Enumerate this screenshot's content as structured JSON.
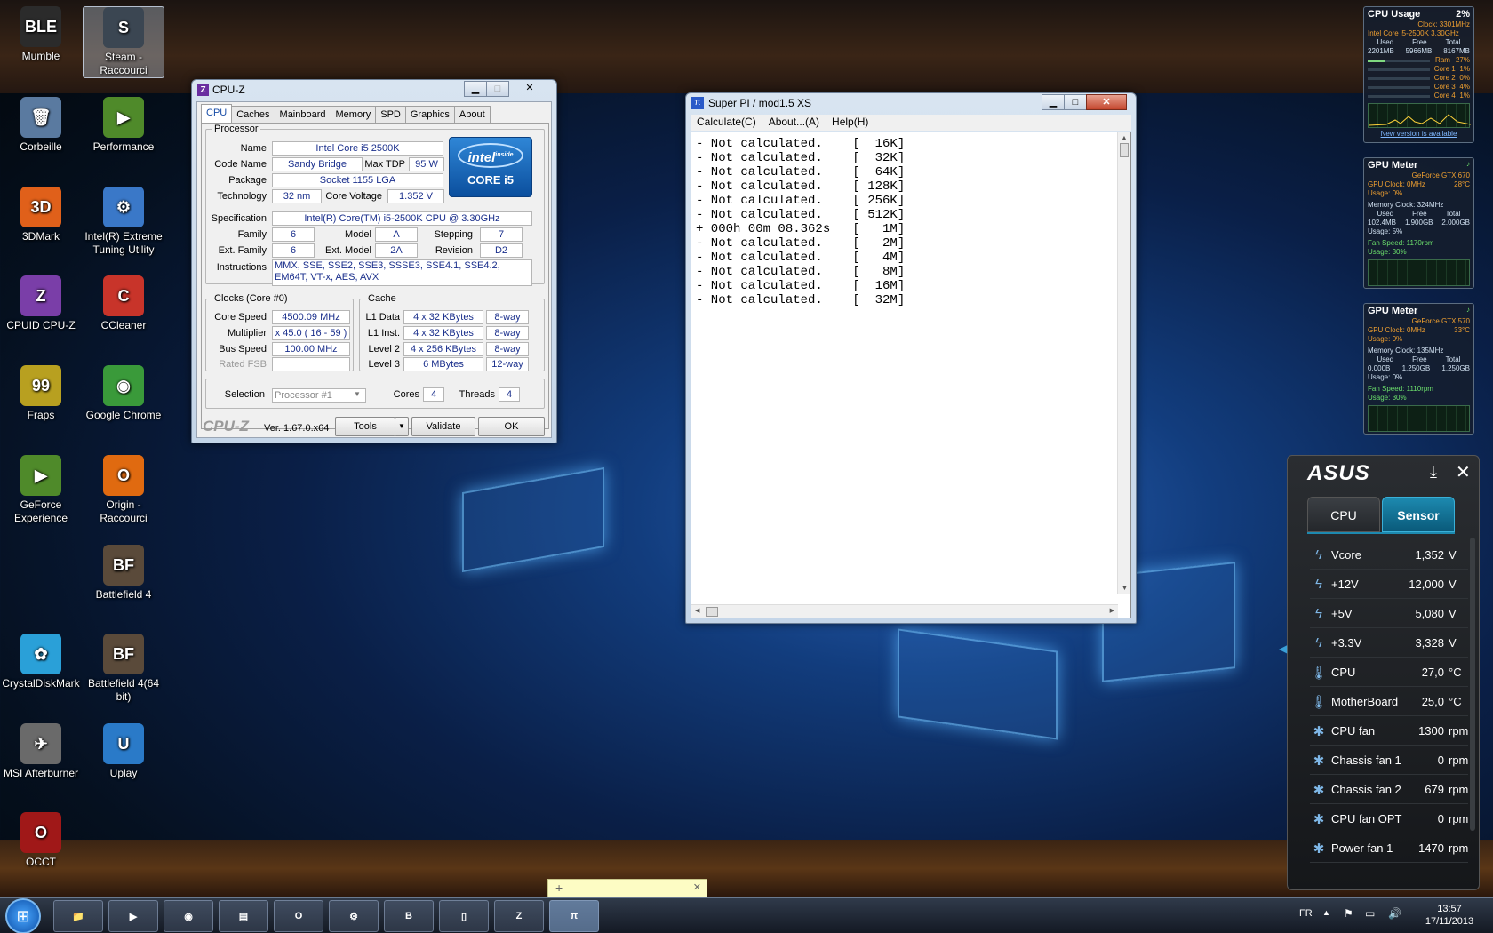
{
  "desktop": {
    "icons": [
      {
        "label": "Mumble",
        "glyph": "BLE",
        "color": "#2b2b2b"
      },
      {
        "label": "Steam - Raccourci",
        "glyph": "S",
        "color": "#3b4652"
      },
      {
        "label": "Corbeille",
        "glyph": "🗑",
        "color": "#5a7aa0"
      },
      {
        "label": "Performance",
        "glyph": "▶",
        "color": "#4f8a2a"
      },
      {
        "label": "3DMark",
        "glyph": "3D",
        "color": "#e0601a"
      },
      {
        "label": "Intel(R) Extreme Tuning Utility",
        "glyph": "⚙",
        "color": "#3a78c8"
      },
      {
        "label": "CPUID CPU-Z",
        "glyph": "Z",
        "color": "#7a3ea8"
      },
      {
        "label": "CCleaner",
        "glyph": "C",
        "color": "#c8342a"
      },
      {
        "label": "Fraps",
        "glyph": "99",
        "color": "#b8a020"
      },
      {
        "label": "Google Chrome",
        "glyph": "◉",
        "color": "#3a9a3a"
      },
      {
        "label": "GeForce Experience",
        "glyph": "▶",
        "color": "#4f8a2a"
      },
      {
        "label": "Origin - Raccourci",
        "glyph": "O",
        "color": "#e06a10"
      },
      {
        "label": "Battlefield 4",
        "glyph": "BF",
        "color": "#5a4a3a"
      },
      {
        "label": "CrystalDiskMark",
        "glyph": "✿",
        "color": "#2aa0d8"
      },
      {
        "label": "Battlefield 4(64 bit)",
        "glyph": "BF",
        "color": "#5a4a3a"
      },
      {
        "label": "MSI Afterburner",
        "glyph": "✈",
        "color": "#6a6a6a"
      },
      {
        "label": "Uplay",
        "glyph": "U",
        "color": "#2a7ac8"
      },
      {
        "label": "OCCT",
        "glyph": "O",
        "color": "#a01818"
      }
    ]
  },
  "cpuz": {
    "title": "CPU-Z",
    "tabs": [
      "CPU",
      "Caches",
      "Mainboard",
      "Memory",
      "SPD",
      "Graphics",
      "About"
    ],
    "processor_label": "Processor",
    "name_label": "Name",
    "name": "Intel Core i5 2500K",
    "codename_label": "Code Name",
    "codename": "Sandy Bridge",
    "maxtdp_label": "Max TDP",
    "maxtdp": "95 W",
    "package_label": "Package",
    "package": "Socket 1155 LGA",
    "tech_label": "Technology",
    "tech": "32 nm",
    "voltage_label": "Core Voltage",
    "voltage": "1.352 V",
    "spec_label": "Specification",
    "spec": "Intel(R) Core(TM) i5-2500K CPU @ 3.30GHz",
    "family_label": "Family",
    "family": "6",
    "model_label": "Model",
    "model": "A",
    "stepping_label": "Stepping",
    "stepping": "7",
    "extfamily_label": "Ext. Family",
    "extfamily": "6",
    "extmodel_label": "Ext. Model",
    "extmodel": "2A",
    "revision_label": "Revision",
    "revision": "D2",
    "instr_label": "Instructions",
    "instr": "MMX, SSE, SSE2, SSE3, SSSE3, SSE4.1, SSE4.2, EM64T, VT-x, AES, AVX",
    "intel_logo": {
      "top": "intel",
      "inside": "inside",
      "bottom": "CORE i5"
    },
    "clocks_label": "Clocks (Core #0)",
    "corespeed_label": "Core Speed",
    "corespeed": "4500.09 MHz",
    "mult_label": "Multiplier",
    "mult": "x 45.0 ( 16 - 59 )",
    "bus_label": "Bus Speed",
    "bus": "100.00 MHz",
    "fsb_label": "Rated FSB",
    "cache_label": "Cache",
    "l1d_label": "L1 Data",
    "l1d": "4 x 32 KBytes",
    "l1d_way": "8-way",
    "l1i_label": "L1 Inst.",
    "l1i": "4 x 32 KBytes",
    "l1i_way": "8-way",
    "l2_label": "Level 2",
    "l2": "4 x 256 KBytes",
    "l2_way": "8-way",
    "l3_label": "Level 3",
    "l3": "6 MBytes",
    "l3_way": "12-way",
    "selection_label": "Selection",
    "selection": "Processor #1",
    "cores_label": "Cores",
    "cores": "4",
    "threads_label": "Threads",
    "threads": "4",
    "brand": "CPU-Z",
    "version": "Ver. 1.67.0.x64",
    "tools_btn": "Tools",
    "validate_btn": "Validate",
    "ok_btn": "OK"
  },
  "superpi": {
    "title": "Super PI / mod1.5 XS",
    "menu": [
      "Calculate(C)",
      "About...(A)",
      "Help(H)"
    ],
    "lines": [
      "- Not calculated.    [  16K]",
      "- Not calculated.    [  32K]",
      "- Not calculated.    [  64K]",
      "- Not calculated.    [ 128K]",
      "- Not calculated.    [ 256K]",
      "- Not calculated.    [ 512K]",
      "+ 000h 00m 08.362s   [   1M]",
      "- Not calculated.    [   2M]",
      "- Not calculated.    [   4M]",
      "- Not calculated.    [   8M]",
      "- Not calculated.    [  16M]",
      "- Not calculated.    [  32M]"
    ]
  },
  "cpu_gadget": {
    "title": "CPU Usage",
    "usage": "2%",
    "clock": "Clock: 3301MHz",
    "cpu": "Intel Core i5-2500K 3.30GHz",
    "h_used": "Used",
    "h_free": "Free",
    "h_total": "Total",
    "used": "2201MB",
    "free": "5966MB",
    "total": "8167MB",
    "ram_label": "Ram",
    "ram_pct": "27%",
    "ram_fill": 0.27,
    "cores": [
      {
        "name": "Core 1",
        "pct": "1%"
      },
      {
        "name": "Core 2",
        "pct": "0%"
      },
      {
        "name": "Core 3",
        "pct": "4%"
      },
      {
        "name": "Core 4",
        "pct": "1%"
      }
    ],
    "link": "New version is available"
  },
  "gpu1": {
    "title": "GPU Meter",
    "model": "GeForce GTX 670",
    "clock": "GPU Clock: 0MHz",
    "temp": "28°C",
    "usage": "Usage: 0%",
    "mem_clock": "Memory Clock: 324MHz",
    "h_used": "Used",
    "h_free": "Free",
    "h_total": "Total",
    "used": "102.4MB",
    "free": "1.900GB",
    "total": "2.000GB",
    "mem_usage": "Usage: 5%",
    "fan": "Fan Speed: 1170rpm",
    "fan_usage": "Usage: 30%"
  },
  "gpu2": {
    "title": "GPU Meter",
    "model": "GeForce GTX 570",
    "clock": "GPU Clock: 0MHz",
    "temp": "33°C",
    "usage": "Usage: 0%",
    "mem_clock": "Memory Clock: 135MHz",
    "h_used": "Used",
    "h_free": "Free",
    "h_total": "Total",
    "used": "0.000B",
    "free": "1.250GB",
    "total": "1.250GB",
    "mem_usage": "Usage: 0%",
    "fan": "Fan Speed: 1110rpm",
    "fan_usage": "Usage: 30%"
  },
  "asus": {
    "brand": "ASUS",
    "tab_cpu": "CPU",
    "tab_sensor": "Sensor",
    "sensors": [
      {
        "icon": "ϟ",
        "name": "Vcore",
        "value": "1,352",
        "unit": "V"
      },
      {
        "icon": "ϟ",
        "name": "+12V",
        "value": "12,000",
        "unit": "V"
      },
      {
        "icon": "ϟ",
        "name": "+5V",
        "value": "5,080",
        "unit": "V"
      },
      {
        "icon": "ϟ",
        "name": "+3.3V",
        "value": "3,328",
        "unit": "V"
      },
      {
        "icon": "🌡",
        "name": "CPU",
        "value": "27,0",
        "unit": "°C"
      },
      {
        "icon": "🌡",
        "name": "MotherBoard",
        "value": "25,0",
        "unit": "°C"
      },
      {
        "icon": "✱",
        "name": "CPU fan",
        "value": "1300",
        "unit": "rpm"
      },
      {
        "icon": "✱",
        "name": "Chassis fan 1",
        "value": "0",
        "unit": "rpm"
      },
      {
        "icon": "✱",
        "name": "Chassis fan 2",
        "value": "679",
        "unit": "rpm"
      },
      {
        "icon": "✱",
        "name": "CPU fan OPT",
        "value": "0",
        "unit": "rpm"
      },
      {
        "icon": "✱",
        "name": "Power fan 1",
        "value": "1470",
        "unit": "rpm"
      }
    ]
  },
  "taskbar": {
    "items": [
      "explorer",
      "media-player",
      "chrome",
      "sticky-notes",
      "origin",
      "intel-xtu",
      "mumble",
      "app",
      "cpu-z",
      "super-pi"
    ],
    "lang": "FR",
    "time": "13:57",
    "date": "17/11/2013"
  }
}
